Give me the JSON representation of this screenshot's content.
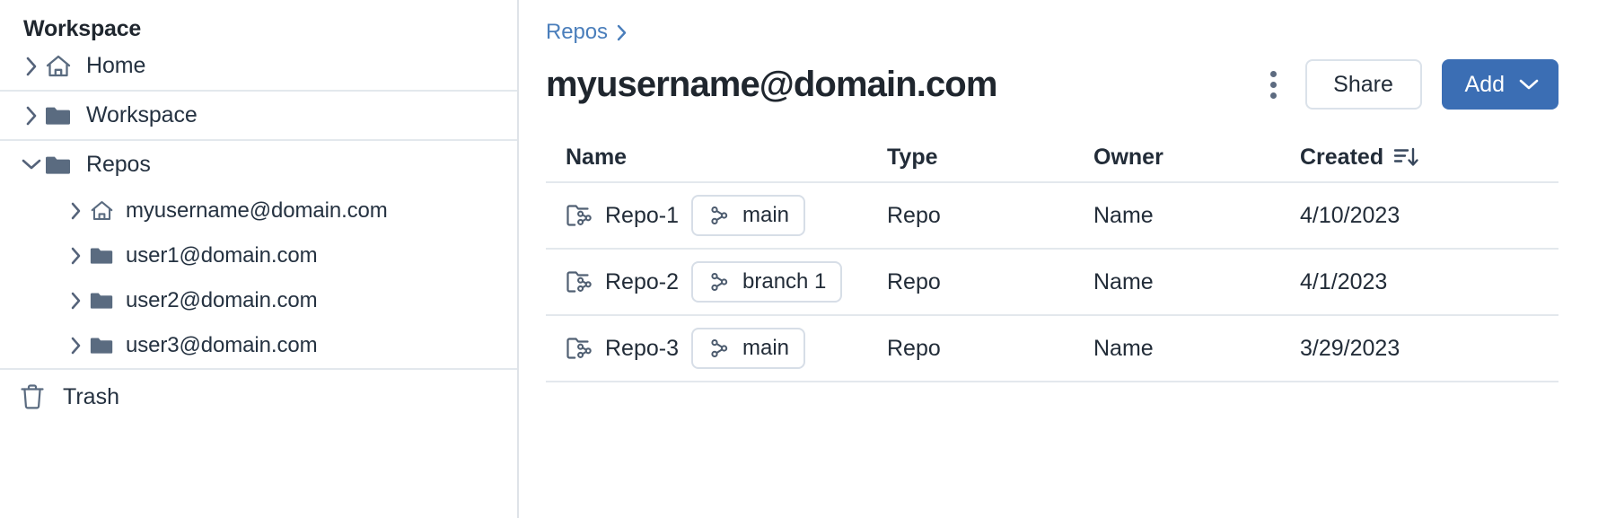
{
  "sidebar": {
    "title": "Workspace",
    "groups": [
      {
        "items": [
          {
            "label": "Home",
            "icon": "home-icon",
            "chevron": "chevron-right",
            "indent": false
          }
        ]
      },
      {
        "items": [
          {
            "label": "Workspace",
            "icon": "folder-icon",
            "chevron": "chevron-right",
            "indent": false
          }
        ]
      },
      {
        "items": [
          {
            "label": "Repos",
            "icon": "folder-icon",
            "chevron": "chevron-down",
            "indent": false
          },
          {
            "label": "myusername@domain.com",
            "icon": "home-icon",
            "chevron": "chevron-right",
            "indent": true
          },
          {
            "label": "user1@domain.com",
            "icon": "folder-icon",
            "chevron": "chevron-right",
            "indent": true
          },
          {
            "label": "user2@domain.com",
            "icon": "folder-icon",
            "chevron": "chevron-right",
            "indent": true
          },
          {
            "label": "user3@domain.com",
            "icon": "folder-icon",
            "chevron": "chevron-right",
            "indent": true
          }
        ]
      }
    ],
    "trash": {
      "label": "Trash",
      "icon": "trash-icon"
    }
  },
  "header": {
    "breadcrumb": {
      "label": "Repos",
      "separator_icon": "chevron-right-icon"
    },
    "title": "myusername@domain.com",
    "kebab_icon": "more-vertical-icon",
    "share_label": "Share",
    "add_label": "Add",
    "add_chevron_icon": "chevron-down-icon",
    "accent_color": "#3b6eb4"
  },
  "table": {
    "columns": [
      "Name",
      "Type",
      "Owner",
      "Created"
    ],
    "sort_icon": "sort-descending-icon",
    "rows": [
      {
        "name": "Repo-1",
        "branch": "main",
        "type": "Repo",
        "owner": "Name",
        "created": "4/10/2023"
      },
      {
        "name": "Repo-2",
        "branch": "branch 1",
        "type": "Repo",
        "owner": "Name",
        "created": "4/1/2023"
      },
      {
        "name": "Repo-3",
        "branch": "main",
        "type": "Repo",
        "owner": "Name",
        "created": "3/29/2023"
      }
    ]
  }
}
